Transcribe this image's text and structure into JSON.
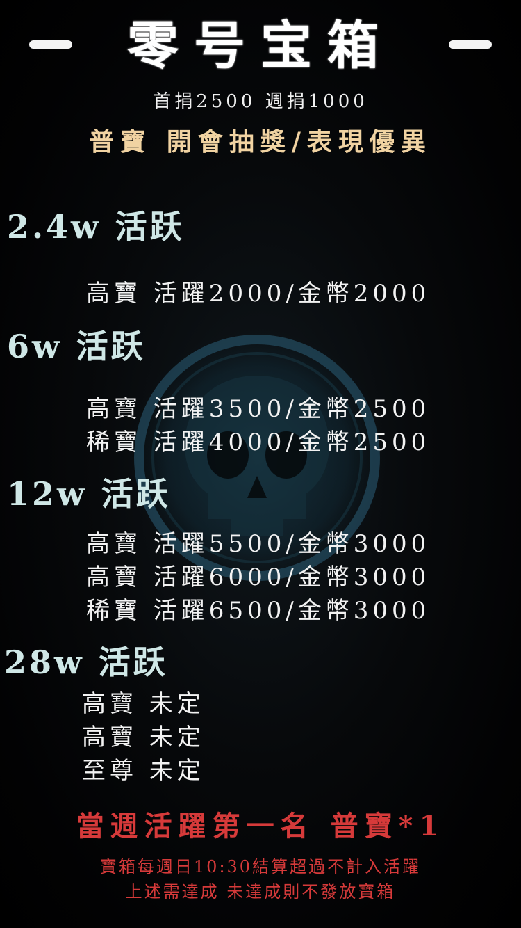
{
  "header": {
    "title": "零号宝箱",
    "subtitle": "首捐2500 週捐1000",
    "tagline": "普寶 開會抽獎/表現優異"
  },
  "tiers": [
    {
      "title": "2.4w 活跃",
      "rewards": [
        "高寶 活躍2000/金幣2000"
      ]
    },
    {
      "title": "6w 活跃",
      "rewards": [
        "高寶 活躍3500/金幣2500",
        "稀寶 活躍4000/金幣2500"
      ]
    },
    {
      "title": "12w 活跃",
      "rewards": [
        "高寶 活躍5500/金幣3000",
        "高寶 活躍6000/金幣3000",
        "稀寶 活躍6500/金幣3000"
      ]
    },
    {
      "title": "28w 活跃",
      "rewards": [
        "高寶 未定",
        "高寶 未定",
        "至尊 未定"
      ]
    }
  ],
  "footer": {
    "main": "當週活躍第一名 普寶*1",
    "note_1": "寶箱每週日10:30結算超過不計入活躍",
    "note_2": "上述需達成 未達成則不發放寶箱"
  },
  "colors": {
    "accent_gold": "#f1d3a2",
    "tier_teal": "#cfe7e6",
    "alert_red": "#d63a3a",
    "emblem_blue": "#2c5f78"
  }
}
